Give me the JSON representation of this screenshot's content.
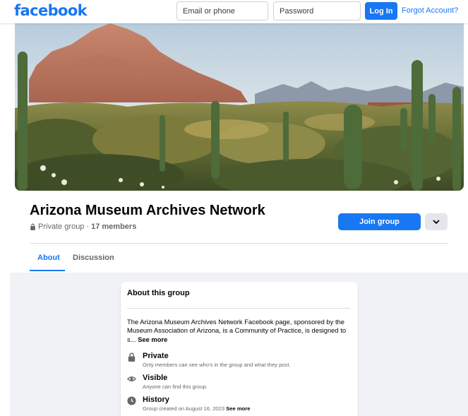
{
  "header": {
    "logo": "facebook",
    "email_placeholder": "Email or phone",
    "password_placeholder": "Password",
    "login_label": "Log In",
    "forgot_label": "Forgot Account?"
  },
  "group": {
    "name": "Arizona Museum Archives Network",
    "privacy": "Private group",
    "separator": " · ",
    "members": "17 members",
    "join_label": "Join group"
  },
  "tabs": [
    {
      "label": "About",
      "active": true
    },
    {
      "label": "Discussion",
      "active": false
    }
  ],
  "about": {
    "title": "About this group",
    "description": "The Arizona Museum Archives Network Facebook page, sponsored by the Museum Association of Arizona, is a Community of Practice, is designed to s...",
    "see_more": "See more",
    "items": [
      {
        "icon": "lock-icon",
        "label": "Private",
        "sub": "Only members can see who's in the group and what they post."
      },
      {
        "icon": "eye-icon",
        "label": "Visible",
        "sub": "Anyone can find this group."
      },
      {
        "icon": "clock-icon",
        "label": "History",
        "sub": "Group created on August 16, 2023",
        "sub_link": "See more"
      }
    ]
  },
  "colors": {
    "brand": "#1877f2",
    "secondary_text": "#65676b",
    "page_bg": "#f0f2f5"
  }
}
